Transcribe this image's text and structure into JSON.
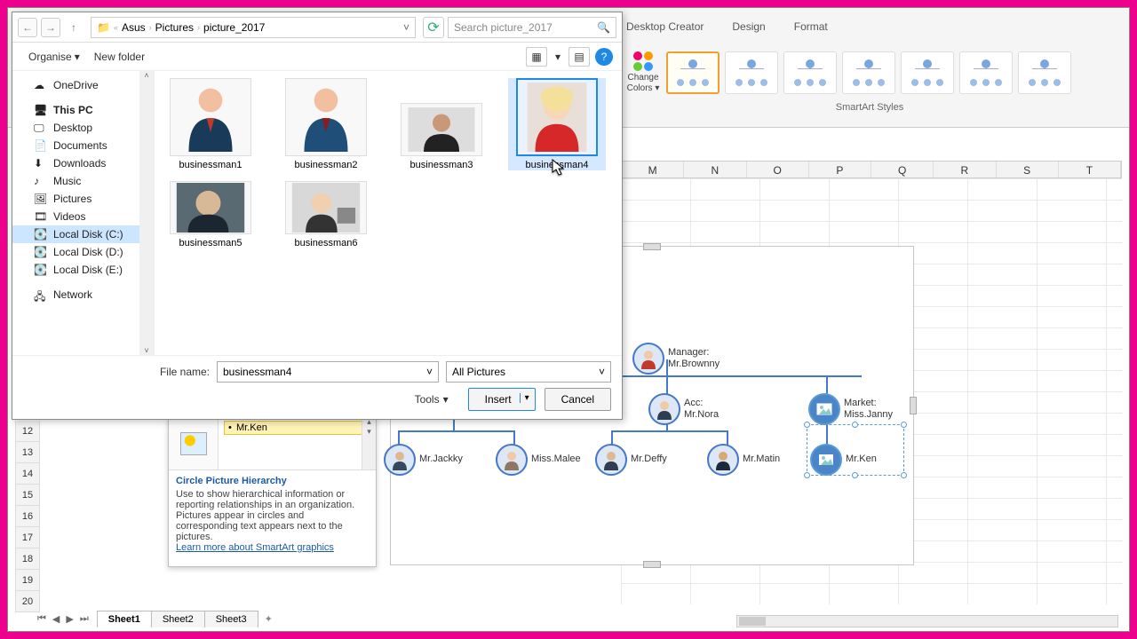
{
  "ribbon": {
    "tabs": [
      "Desktop Creator",
      "Design",
      "Format"
    ],
    "change_colors": "Change Colors",
    "styles_label": "SmartArt Styles"
  },
  "columns": [
    "M",
    "N",
    "O",
    "P",
    "Q",
    "R",
    "S",
    "T"
  ],
  "rows": [
    "12",
    "13",
    "14",
    "15",
    "16",
    "17",
    "18",
    "19",
    "20"
  ],
  "sheets": {
    "active": "Sheet1",
    "others": [
      "Sheet2",
      "Sheet3"
    ]
  },
  "dialog": {
    "breadcrumb": {
      "p1": "Asus",
      "p2": "Pictures",
      "p3": "picture_2017"
    },
    "search_placeholder": "Search picture_2017",
    "organise": "Organise",
    "new_folder": "New folder",
    "tree": {
      "onedrive": "OneDrive",
      "thispc": "This PC",
      "desktop": "Desktop",
      "documents": "Documents",
      "downloads": "Downloads",
      "music": "Music",
      "pictures": "Pictures",
      "videos": "Videos",
      "diskc": "Local Disk (C:)",
      "diskd": "Local Disk (D:)",
      "diske": "Local Disk (E:)",
      "network": "Network"
    },
    "files": {
      "f1": "businessman1",
      "f2": "businessman2",
      "f3": "businessman3",
      "f4": "businessman4",
      "f5": "businessman5",
      "f6": "businessman6"
    },
    "filename_label": "File name:",
    "filename_value": "businessman4",
    "filter": "All Pictures",
    "tools": "Tools",
    "insert": "Insert",
    "cancel": "Cancel"
  },
  "textpane": {
    "item": "Mr.Ken",
    "title": "Circle Picture Hierarchy",
    "desc": "Use to show hierarchical information or reporting relationships in an organization. Pictures appear in circles and corresponding text appears next to the pictures.",
    "link": "Learn more about SmartArt graphics"
  },
  "org": {
    "mgr_label": "Manager:",
    "mgr_name": "Mr.Brownny",
    "acc_label": "Acc:",
    "acc_name": "Mr.Nora",
    "mkt_label": "Market:",
    "mkt_name": "Miss.Janny",
    "p1": "Mr.Jackky",
    "p2": "Miss.Malee",
    "p3": "Mr.Deffy",
    "p4": "Mr.Matin",
    "p5": "Mr.Ken"
  }
}
